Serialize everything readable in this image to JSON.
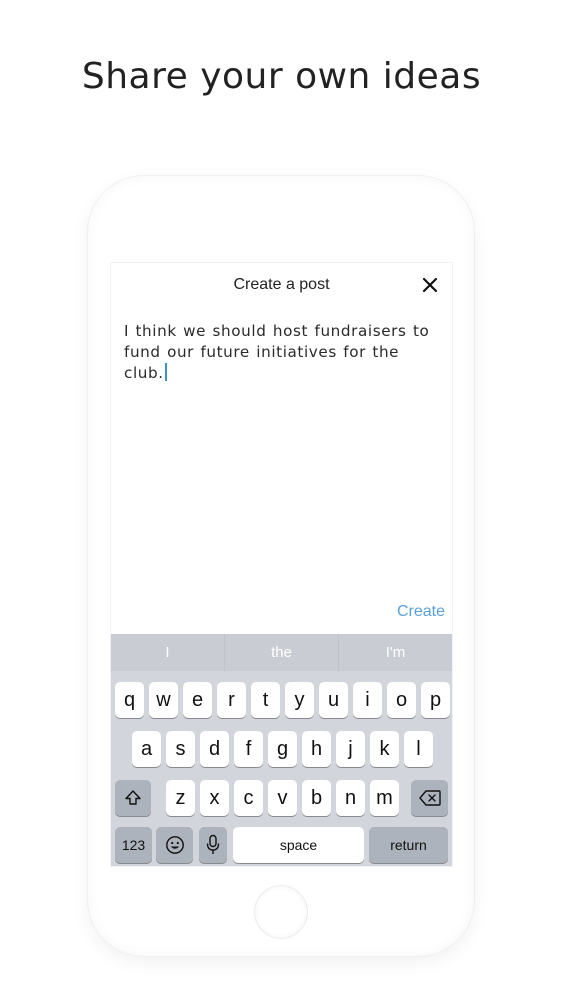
{
  "headline": "Share your own ideas",
  "post": {
    "title": "Create a post",
    "close_icon": "close-icon",
    "body_text": "I think we should host fundraisers to fund our future initiatives for the club.",
    "create_label": "Create"
  },
  "keyboard": {
    "suggestions": [
      "I",
      "the",
      "I'm"
    ],
    "row1": [
      "q",
      "w",
      "e",
      "r",
      "t",
      "y",
      "u",
      "i",
      "o",
      "p"
    ],
    "row2": [
      "a",
      "s",
      "d",
      "f",
      "g",
      "h",
      "j",
      "k",
      "l"
    ],
    "row3": [
      "z",
      "x",
      "c",
      "v",
      "b",
      "n",
      "m"
    ],
    "shift_icon": "shift-icon",
    "backspace_icon": "backspace-icon",
    "numbers_label": "123",
    "emoji_icon": "emoji-icon",
    "mic_icon": "microphone-icon",
    "space_label": "space",
    "return_label": "return"
  }
}
